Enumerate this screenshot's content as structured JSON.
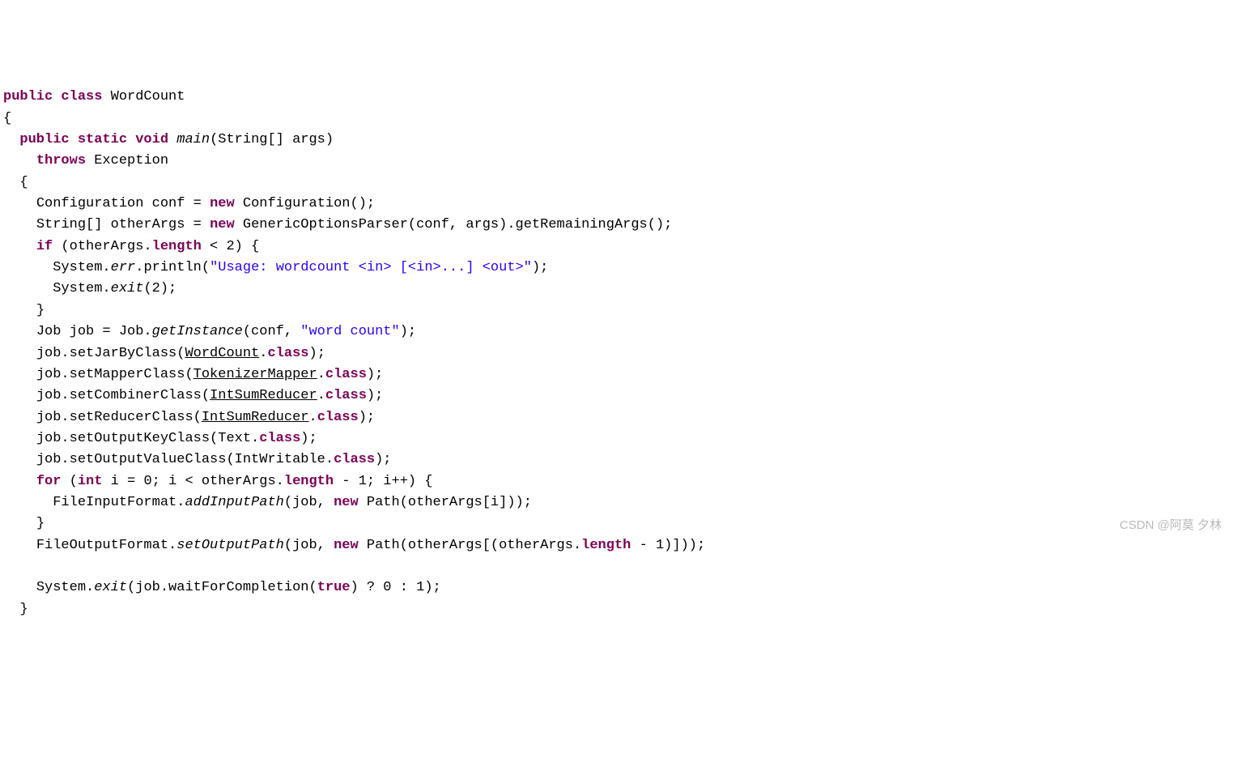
{
  "code": {
    "class_kw": "public class",
    "class_name": "WordCount",
    "method_sig_kw1": "public static void",
    "method_name": "main",
    "method_params": "(String[] args)",
    "throws_kw": "throws",
    "throws_type": "Exception",
    "conf_decl_pre": "Configuration conf = ",
    "new_kw": "new",
    "conf_decl_post": " Configuration();",
    "otherargs_pre": "String[] otherArgs = ",
    "otherargs_post": " GenericOptionsParser(conf, args).getRemainingArgs();",
    "if_kw": "if",
    "if_cond_pre": " (otherArgs.",
    "length_kw": "length",
    "if_cond_post": " < 2) {",
    "syserr_pre": "System.",
    "err_ident": "err",
    "println_open": ".println(",
    "usage_str": "\"Usage: wordcount <in> [<in>...] <out>\"",
    "println_close": ");",
    "sysexit_pre": "System.",
    "exit_ident": "exit",
    "exit_arg": "(2);",
    "close_brace": "}",
    "job_pre": "Job job = Job.",
    "getInstance_ident": "getInstance",
    "job_mid": "(conf, ",
    "job_str": "\"word count\"",
    "job_post": ");",
    "jar_pre": "job.setJarByClass(",
    "wordcount_link": "WordCount",
    "dot_class": ".",
    "class_kw_lit": "class",
    "paren_semi": ");",
    "mapper_pre": "job.setMapperClass(",
    "tokenizer_link": "TokenizerMapper",
    "combiner_pre": "job.setCombinerClass(",
    "intsum_link": "IntSumReducer",
    "reducer_pre": "job.setReducerClass(",
    "outkey_pre": "job.setOutputKeyClass(Text.",
    "outval_pre": "job.setOutputValueClass(IntWritable.",
    "for_kw": "for",
    "int_kw": "int",
    "for_init": " i = 0; i < otherArgs.",
    "for_post": " - 1; i++) {",
    "fip_pre": "FileInputFormat.",
    "addInputPath_ident": "addInputPath",
    "fip_mid": "(job, ",
    "fip_post": " Path(otherArgs[i]));",
    "fof_pre": "FileOutputFormat.",
    "setOutputPath_ident": "setOutputPath",
    "fof_mid": "(job, ",
    "fof_post": " Path(otherArgs[(otherArgs.",
    "fof_end": " - 1)]));",
    "finalexit_pre": "System.",
    "finalexit_mid": "(job.waitForCompletion(",
    "true_kw": "true",
    "finalexit_post": ") ? 0 : 1);",
    "open_brace": "{",
    "for_open": " ("
  },
  "watermark": "CSDN @阿莫 夕林"
}
